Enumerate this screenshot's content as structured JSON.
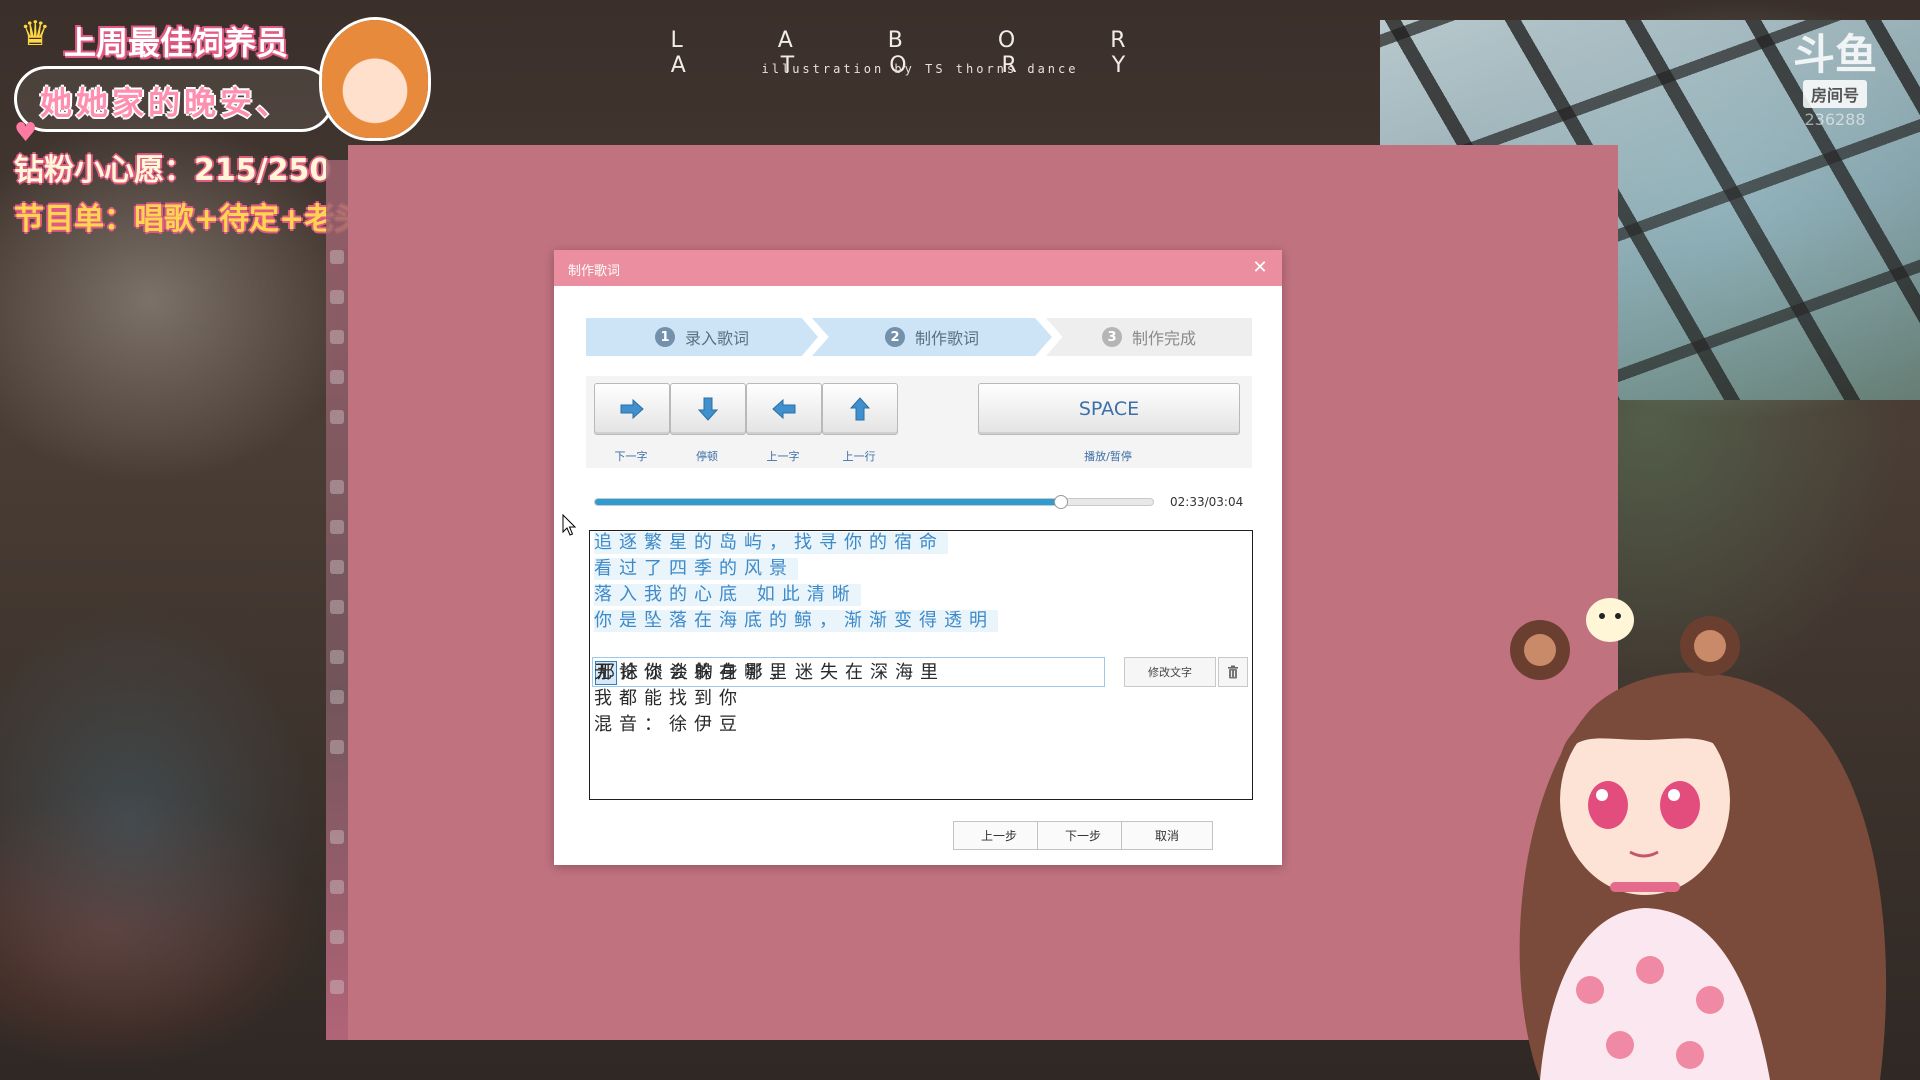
{
  "stream": {
    "title": "L A B O R A T O R Y",
    "subtitle": "illustration by TS thorns dance",
    "platform_logo": "斗鱼",
    "room_label": "房间号",
    "room_number": "236288"
  },
  "overlay": {
    "weekly_best": "上周最佳饲养员",
    "name": "她她家的晚安、",
    "wish": "钻粉小心愿：215/250",
    "program": "节目单：唱歌+待定+老头环"
  },
  "dialog": {
    "title": "制作歌词",
    "steps": [
      {
        "num": "1",
        "label": "录入歌词"
      },
      {
        "num": "2",
        "label": "制作歌词"
      },
      {
        "num": "3",
        "label": "制作完成"
      }
    ],
    "controls": {
      "next_char": "下一字",
      "pause": "停顿",
      "prev_char": "上一字",
      "prev_line": "上一行",
      "space": "SPACE",
      "play_pause": "播放/暂停"
    },
    "progress": {
      "fraction": 0.835,
      "time": "02:33/03:04"
    },
    "lyrics": {
      "done_lines": [
        "追逐繁星的岛屿，找寻你的宿命",
        "看过了四季的风景",
        "落入我的心底 如此清晰",
        "你是坠落在海底的鲸，渐渐变得透明"
      ],
      "current_first_char": "那",
      "current_rest": "抹淡淡的身影，迷失在深海里",
      "pending_lines": [
        "无论你会躲在哪里",
        "我都能找到你",
        "混音：徐伊豆"
      ],
      "edit_button": "修改文字"
    },
    "footer": {
      "prev": "上一步",
      "next": "下一步",
      "cancel": "取消"
    }
  },
  "colors": {
    "dialog_titlebar": "#eb8fa0",
    "pink_app_bg": "#c0727f",
    "accent_blue": "#2f9ccf",
    "step_active": "#cde4f6"
  }
}
